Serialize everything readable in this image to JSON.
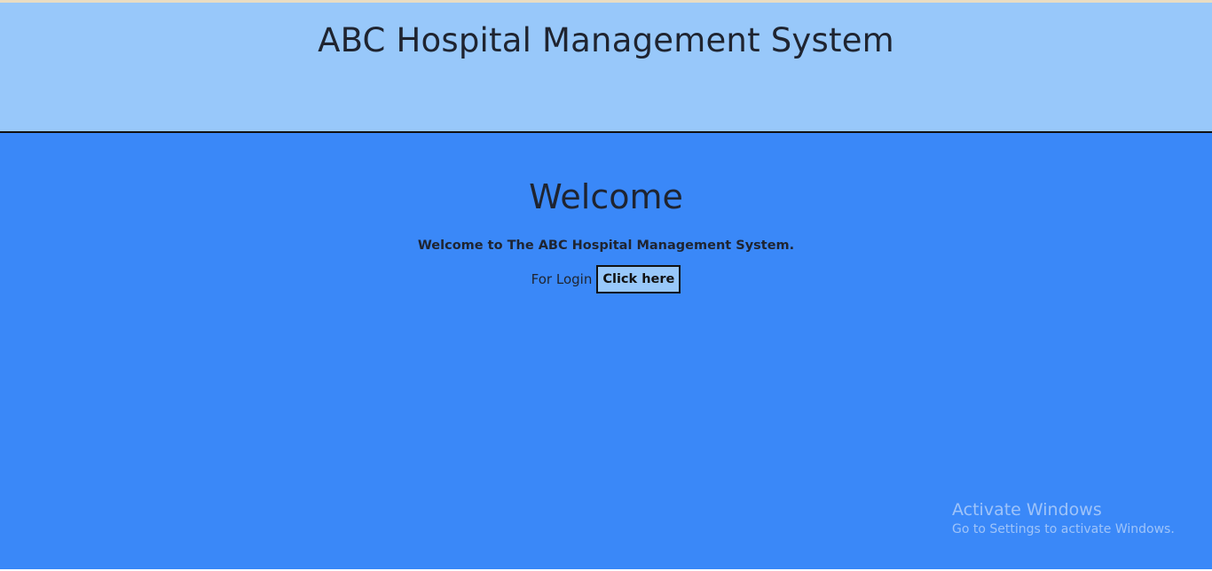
{
  "header": {
    "title": "ABC Hospital Management System"
  },
  "main": {
    "heading": "Welcome",
    "welcome_text": "Welcome to The ABC Hospital Management System.",
    "login_label": "For Login",
    "login_button": "Click here"
  },
  "watermark": {
    "title": "Activate Windows",
    "subtitle": "Go to Settings to activate Windows."
  },
  "colors": {
    "header_bg": "#98c8fa",
    "main_bg": "#3a88f8",
    "text": "#1f2430"
  }
}
